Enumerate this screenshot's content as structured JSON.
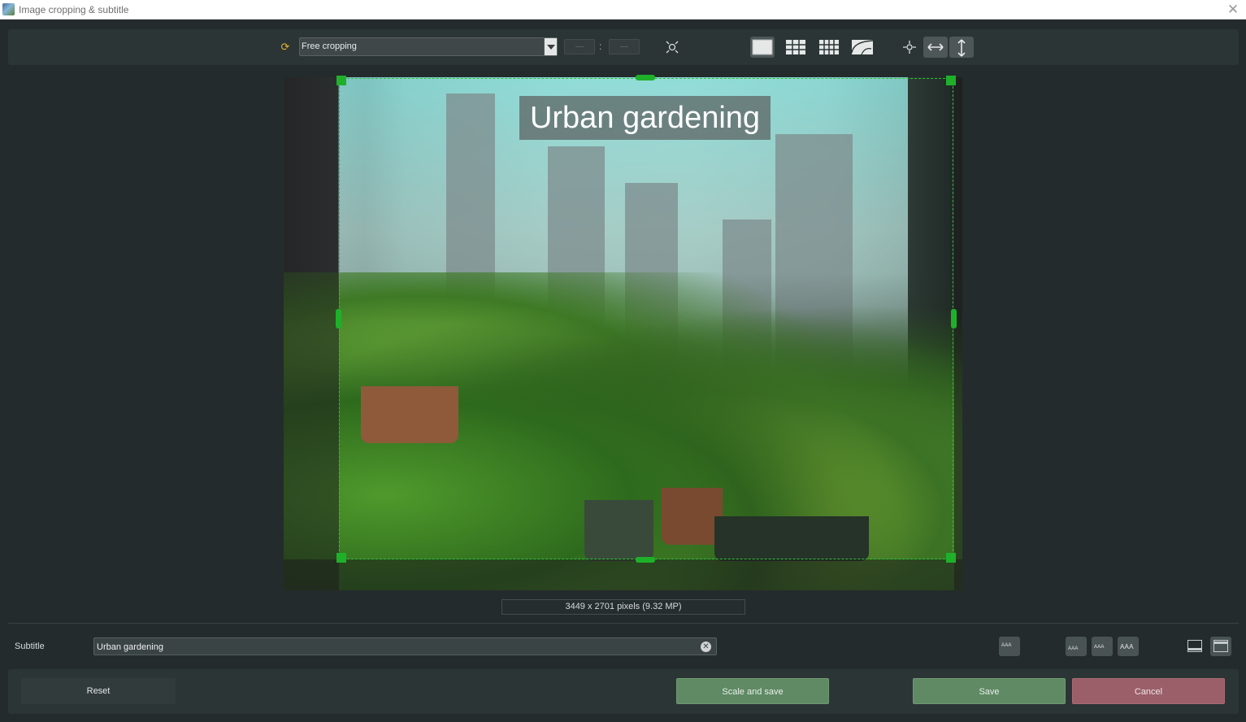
{
  "window": {
    "title": "Image cropping & subtitle",
    "close_symbol": "✕"
  },
  "toolbar": {
    "sync_icon": "sync-icon",
    "crop_mode": "Free cropping",
    "ratio_width_placeholder": "—",
    "ratio_height_placeholder": "—",
    "ratio_separator": ":",
    "tools": [
      "fit-to-frame-icon",
      "no-grid-icon",
      "grid-3x3-icon",
      "grid-4x3-icon",
      "rotate-icon",
      "center-icon",
      "flip-horizontal-icon",
      "flip-vertical-icon"
    ]
  },
  "preview": {
    "overlay_subtitle": "Urban gardening",
    "dimensions": "3449 x 2701 pixels (9.32 MP)"
  },
  "subtitle": {
    "label": "Subtitle",
    "value": "Urban gardening",
    "clear_symbol": "✕",
    "style_buttons": [
      "AAA",
      "AAA",
      "AAA",
      "AAA"
    ]
  },
  "actions": {
    "reset": "Reset",
    "scale_and_save": "Scale and save",
    "save": "Save",
    "cancel": "Cancel"
  },
  "colors": {
    "background": "#242b2c",
    "panel": "#2c3536",
    "crop_frame": "#1fb02a",
    "save_button": "#5f8a64",
    "cancel_button": "#9a5f68"
  }
}
